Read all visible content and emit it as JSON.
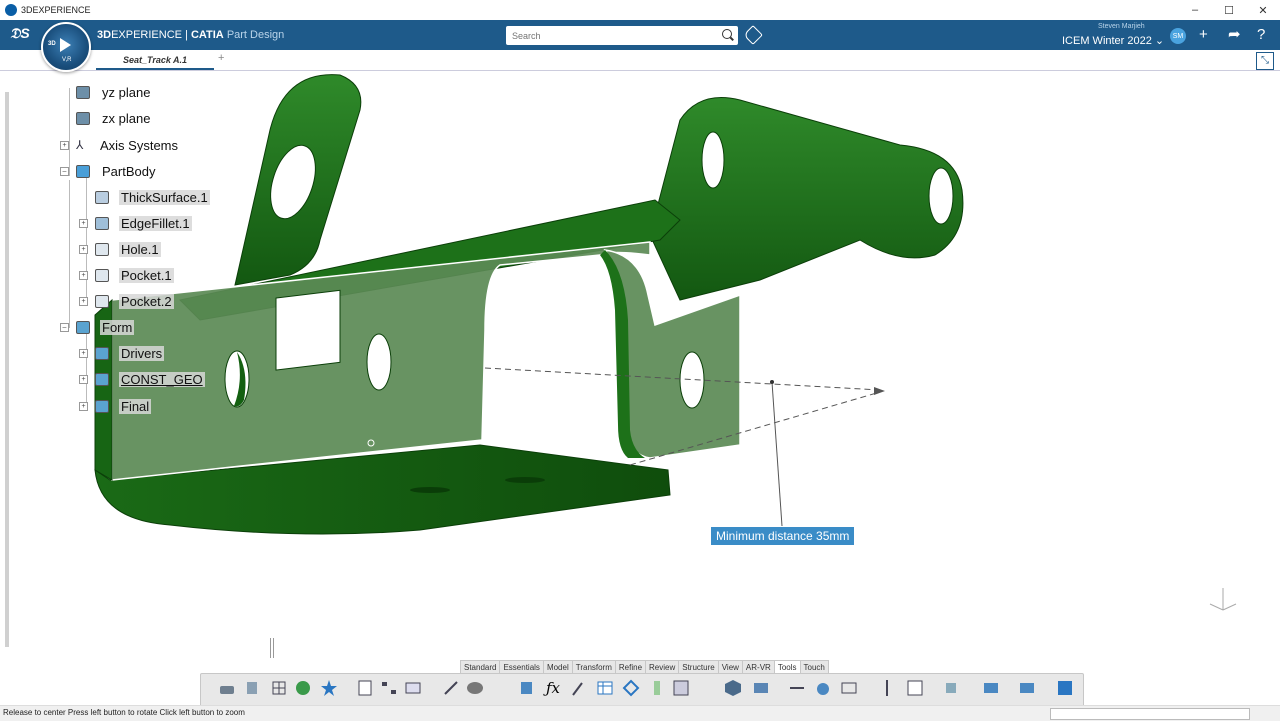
{
  "window": {
    "title": "3DEXPERIENCE",
    "minimize": "–",
    "maximize": "☐",
    "close": "✕"
  },
  "header": {
    "brand_bold": "3D",
    "brand_rest": "EXPERIENCE | ",
    "app_name": "CATIA",
    "app_role": "Part Design",
    "search_placeholder": "Search",
    "user_name": "Steven Marjieh",
    "tenant": "ICEM Winter 2022 ⌄",
    "avatar_initials": "SM",
    "compass_3d": "3D",
    "compass_vr": "V,R"
  },
  "tabs": {
    "active": "Seat_Track A.1",
    "add": "+"
  },
  "tree": {
    "items": [
      {
        "label": "yz plane"
      },
      {
        "label": "zx plane"
      },
      {
        "label": "Axis Systems"
      },
      {
        "label": "PartBody"
      },
      {
        "label": "ThickSurface.1"
      },
      {
        "label": "EdgeFillet.1"
      },
      {
        "label": "Hole.1"
      },
      {
        "label": "Pocket.1"
      },
      {
        "label": "Pocket.2"
      },
      {
        "label": "Form"
      },
      {
        "label": "Drivers"
      },
      {
        "label": "CONST_GEO"
      },
      {
        "label": "Final"
      }
    ]
  },
  "canvas": {
    "measure_label": "Minimum distance 35mm"
  },
  "section_tabs": [
    "Standard",
    "Essentials",
    "Model",
    "Transform",
    "Refine",
    "Review",
    "Structure",
    "View",
    "AR-VR",
    "Tools",
    "Touch"
  ],
  "active_section": "Tools",
  "status": {
    "hint": "Release to center  Press left button to rotate  Click left button to zoom"
  },
  "colors": {
    "header": "#1e5a8a",
    "part_green": "#1f6e1a",
    "measure_blue": "#3a8cc7"
  }
}
